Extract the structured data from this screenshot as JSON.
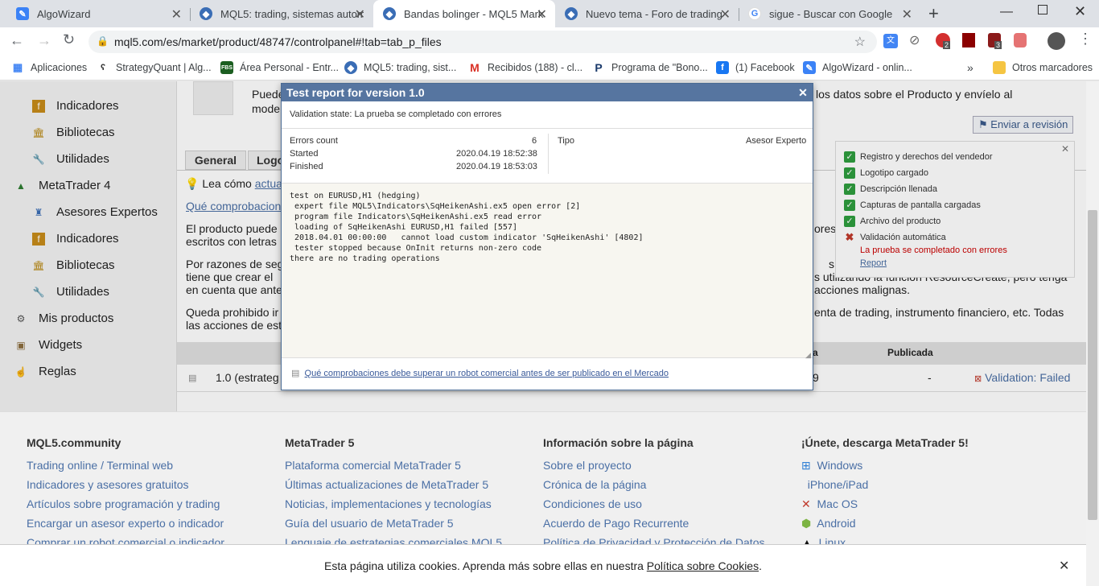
{
  "tabs": [
    {
      "title": "AlgoWizard",
      "icon": "algowizard-icon"
    },
    {
      "title": "MQL5: trading, sistemas autom",
      "icon": "mql5-icon"
    },
    {
      "title": "Bandas bolinger - MQL5 Mark",
      "icon": "mql5-icon"
    },
    {
      "title": "Nuevo tema - Foro de trading",
      "icon": "mql5-icon"
    },
    {
      "title": "sigue - Buscar con Google",
      "icon": "google-icon"
    }
  ],
  "address": {
    "url": "mql5.com/es/market/product/48747/controlpanel#!tab=tab_p_files"
  },
  "bookmarks": [
    {
      "label": "Aplicaciones",
      "icon": "apps-icon"
    },
    {
      "label": "StrategyQuant | Alg...",
      "icon": "strategyquant-icon"
    },
    {
      "label": "Área Personal - Entr...",
      "icon": "fbs-icon"
    },
    {
      "label": "MQL5: trading, sist...",
      "icon": "mql5-icon"
    },
    {
      "label": "Recibidos (188) - cl...",
      "icon": "gmail-icon"
    },
    {
      "label": "Programa de \"Bono...",
      "icon": "bono-icon"
    },
    {
      "label": "(1) Facebook",
      "icon": "facebook-icon"
    },
    {
      "label": "AlgoWizard - onlin...",
      "icon": "algowizard-icon"
    }
  ],
  "bookmarks_more": "»",
  "other_bookmarks": "Otros marcadores",
  "extension_badges": {
    "opera": "2",
    "shield": "3"
  },
  "sidebar": {
    "items": [
      {
        "label": "Indicadores",
        "icon": "indicator-icon"
      },
      {
        "label": "Bibliotecas",
        "icon": "library-icon"
      },
      {
        "label": "Utilidades",
        "icon": "wrench-icon"
      },
      {
        "label": "MetaTrader 4",
        "icon": "metatrader-icon"
      },
      {
        "label": "Asesores Expertos",
        "icon": "expert-icon"
      },
      {
        "label": "Indicadores",
        "icon": "indicator-icon"
      },
      {
        "label": "Bibliotecas",
        "icon": "library-icon"
      },
      {
        "label": "Utilidades",
        "icon": "wrench-icon"
      },
      {
        "label": "Mis productos",
        "icon": "products-icon"
      },
      {
        "label": "Widgets",
        "icon": "widgets-icon"
      },
      {
        "label": "Reglas",
        "icon": "rules-icon"
      }
    ]
  },
  "main": {
    "intro_text": "Puede",
    "intro_text2": "mode",
    "intro_right": "los datos sobre el Producto y envíelo al",
    "submit_button": "Enviar a revisión",
    "tabs": [
      "General",
      "Logo"
    ],
    "learn_prefix": "Lea cómo",
    "learn_link": "actual",
    "checks_link": "Qué comprobacion",
    "para1": "El producto puede",
    "para1b": "escritos con letras",
    "para2": "Por razones de seg",
    "para2b": "tiene que crear el",
    "para2c": "en cuenta que ante",
    "para3": "Queda prohibido ir",
    "para3b": "las acciones de est",
    "right1": "ores",
    "right2": "s",
    "right3": "s utilizando la función ResourceCreate, pero tenga",
    "right4": "acciones malignas.",
    "right5": "enta de trading, instrumento financiero, etc. Todas",
    "table_header_a": "a",
    "table_header_published": "Publicada",
    "row_version": "1.0 (estrateg",
    "row_value": "9",
    "row_dash": "-",
    "row_status": "Validation: Failed"
  },
  "checklist": {
    "items": [
      {
        "label": "Registro y derechos del vendedor",
        "ok": true
      },
      {
        "label": "Logotipo cargado",
        "ok": true
      },
      {
        "label": "Descripción llenada",
        "ok": true
      },
      {
        "label": "Capturas de pantalla cargadas",
        "ok": true
      },
      {
        "label": "Archivo del producto",
        "ok": true
      },
      {
        "label": "Validación automática",
        "ok": false
      }
    ],
    "error_text": "La prueba se completado con errores",
    "report_link": "Report"
  },
  "dialog": {
    "title": "Test report for version 1.0",
    "validation_state": "Validation state: La prueba se completado con errores",
    "errors_label": "Errors count",
    "errors_value": "6",
    "started_label": "Started",
    "started_value": "2020.04.19 18:52:38",
    "finished_label": "Finished",
    "finished_value": "2020.04.19 18:53:03",
    "type_label": "Tipo",
    "type_value": "Asesor Experto",
    "log": "test on EURUSD,H1 (hedging)\n expert file MQL5\\Indicators\\SqHeikenAshi.ex5 open error [2]\n program file Indicators\\SqHeikenAshi.ex5 read error\n loading of SqHeikenAshi EURUSD,H1 failed [557]\n 2018.04.01 00:00:00   cannot load custom indicator 'SqHeikenAshi' [4802]\n tester stopped because OnInit returns non-zero code\nthere are no trading operations",
    "footer_link": "Qué comprobaciones debe superar un robot comercial antes de ser publicado en el Mercado"
  },
  "footer": {
    "columns": [
      {
        "title": "MQL5.community",
        "links": [
          "Trading online / Terminal web",
          "Indicadores y asesores gratuitos",
          "Artículos sobre programación y trading",
          "Encargar un asesor experto o indicador",
          "Comprar un robot comercial o indicador"
        ]
      },
      {
        "title": "MetaTrader 5",
        "links": [
          "Plataforma comercial MetaTrader 5",
          "Últimas actualizaciones de MetaTrader 5",
          "Noticias, implementaciones y tecnologías",
          "Guía del usuario de MetaTrader 5",
          "Lenguaje de estrategias comerciales MQL5"
        ]
      },
      {
        "title": "Información sobre la página",
        "links": [
          "Sobre el proyecto",
          "Crónica de la página",
          "Condiciones de uso",
          "Acuerdo de Pago Recurrente",
          "Política de Privacidad y Protección de Datos"
        ]
      },
      {
        "title": "¡Únete, descarga MetaTrader 5!",
        "links": [
          "Windows",
          "iPhone/iPad",
          "Mac OS",
          "Android",
          "Linux"
        ]
      }
    ]
  },
  "cookie": {
    "text": "Esta página utiliza cookies. Aprenda más sobre ellas en nuestra",
    "link": "Política sobre Cookies",
    "period": "."
  },
  "colors": {
    "link": "#4a6fa5",
    "dialog_header": "#5675a0",
    "error": "#cc0000",
    "ok": "#2e9e3e"
  }
}
